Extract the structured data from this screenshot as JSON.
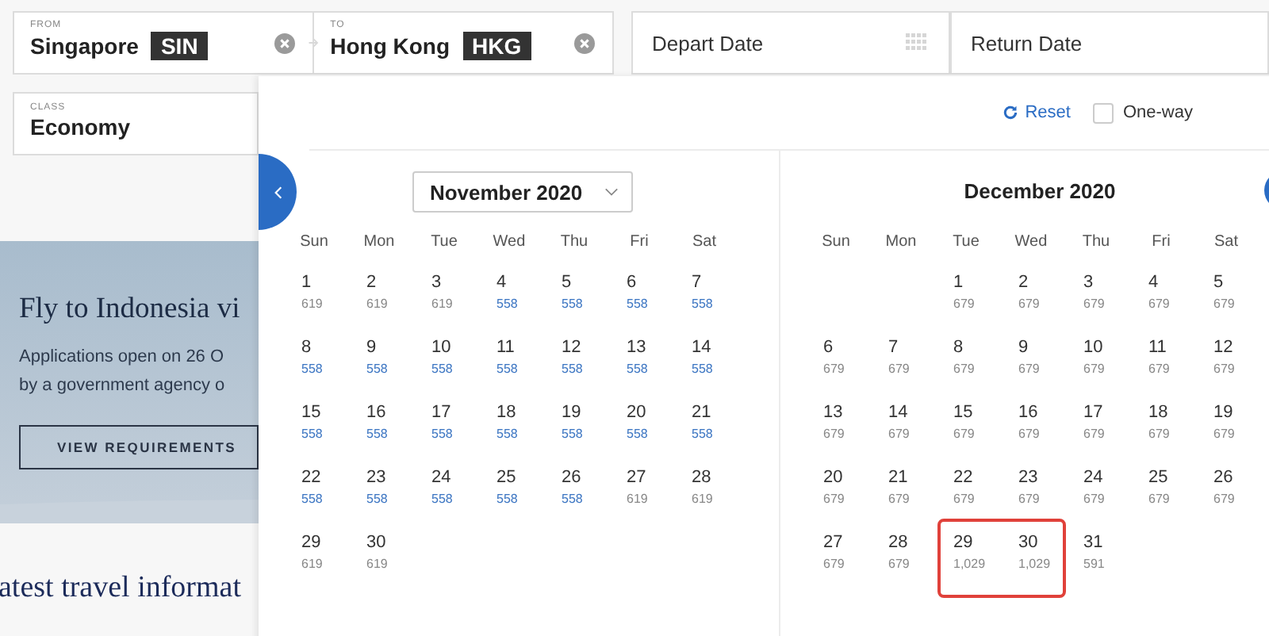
{
  "search": {
    "from": {
      "label": "FROM",
      "city": "Singapore",
      "code": "SIN"
    },
    "to": {
      "label": "TO",
      "city": "Hong Kong",
      "code": "HKG"
    },
    "depart": {
      "placeholder": "Depart Date"
    },
    "return": {
      "placeholder": "Return Date"
    },
    "class": {
      "label": "CLASS",
      "value": "Economy"
    }
  },
  "promo": {
    "title": "Fly to Indonesia vi",
    "text_lines": [
      "Applications open on 26 O",
      "by a government agency o"
    ],
    "button": "VIEW REQUIREMENTS"
  },
  "section_heading": "atest travel informat",
  "calendar": {
    "reset": "Reset",
    "one_way": {
      "label": "One-way",
      "checked": false
    },
    "months": [
      {
        "title": "November 2020",
        "kind": "dropdown",
        "weekdays": [
          "Sun",
          "Mon",
          "Tue",
          "Wed",
          "Thu",
          "Fri",
          "Sat"
        ],
        "weeks": [
          {
            "kind": "start",
            "days": [
              {
                "day": "1",
                "price": "619",
                "low_fare": false
              },
              {
                "day": "2",
                "price": "619",
                "low_fare": false
              },
              {
                "day": "3",
                "price": "619",
                "low_fare": false
              },
              {
                "day": "4",
                "price": "558",
                "low_fare": true
              },
              {
                "day": "5",
                "price": "558",
                "low_fare": true
              },
              {
                "day": "6",
                "price": "558",
                "low_fare": true
              },
              {
                "day": "7",
                "price": "558",
                "low_fare": true
              }
            ]
          },
          {
            "kind": "start",
            "days": [
              {
                "day": "8",
                "price": "558",
                "low_fare": true
              },
              {
                "day": "9",
                "price": "558",
                "low_fare": true
              },
              {
                "day": "10",
                "price": "558",
                "low_fare": true
              },
              {
                "day": "11",
                "price": "558",
                "low_fare": true
              },
              {
                "day": "12",
                "price": "558",
                "low_fare": true
              },
              {
                "day": "13",
                "price": "558",
                "low_fare": true
              },
              {
                "day": "14",
                "price": "558",
                "low_fare": true
              }
            ]
          },
          {
            "kind": "start",
            "days": [
              {
                "day": "15",
                "price": "558",
                "low_fare": true
              },
              {
                "day": "16",
                "price": "558",
                "low_fare": true
              },
              {
                "day": "17",
                "price": "558",
                "low_fare": true
              },
              {
                "day": "18",
                "price": "558",
                "low_fare": true
              },
              {
                "day": "19",
                "price": "558",
                "low_fare": true
              },
              {
                "day": "20",
                "price": "558",
                "low_fare": true
              },
              {
                "day": "21",
                "price": "558",
                "low_fare": true
              }
            ]
          },
          {
            "kind": "start",
            "days": [
              {
                "day": "22",
                "price": "558",
                "low_fare": true
              },
              {
                "day": "23",
                "price": "558",
                "low_fare": true
              },
              {
                "day": "24",
                "price": "558",
                "low_fare": true
              },
              {
                "day": "25",
                "price": "558",
                "low_fare": true
              },
              {
                "day": "26",
                "price": "558",
                "low_fare": true
              },
              {
                "day": "27",
                "price": "619",
                "low_fare": false
              },
              {
                "day": "28",
                "price": "619",
                "low_fare": false
              }
            ]
          },
          {
            "kind": "start",
            "days": [
              {
                "day": "29",
                "price": "619",
                "low_fare": false
              },
              {
                "day": "30",
                "price": "619",
                "low_fare": false
              }
            ]
          }
        ]
      },
      {
        "title": "December 2020",
        "kind": "label",
        "weekdays": [
          "Sun",
          "Mon",
          "Tue",
          "Wed",
          "Thu",
          "Fri",
          "Sat"
        ],
        "weeks": [
          {
            "kind": "end",
            "days": [
              {
                "day": "1",
                "price": "679",
                "low_fare": false
              },
              {
                "day": "2",
                "price": "679",
                "low_fare": false
              },
              {
                "day": "3",
                "price": "679",
                "low_fare": false
              },
              {
                "day": "4",
                "price": "679",
                "low_fare": false
              },
              {
                "day": "5",
                "price": "679",
                "low_fare": false
              }
            ]
          },
          {
            "kind": "start",
            "days": [
              {
                "day": "6",
                "price": "679",
                "low_fare": false
              },
              {
                "day": "7",
                "price": "679",
                "low_fare": false
              },
              {
                "day": "8",
                "price": "679",
                "low_fare": false
              },
              {
                "day": "9",
                "price": "679",
                "low_fare": false
              },
              {
                "day": "10",
                "price": "679",
                "low_fare": false
              },
              {
                "day": "11",
                "price": "679",
                "low_fare": false
              },
              {
                "day": "12",
                "price": "679",
                "low_fare": false
              }
            ]
          },
          {
            "kind": "start",
            "days": [
              {
                "day": "13",
                "price": "679",
                "low_fare": false
              },
              {
                "day": "14",
                "price": "679",
                "low_fare": false
              },
              {
                "day": "15",
                "price": "679",
                "low_fare": false
              },
              {
                "day": "16",
                "price": "679",
                "low_fare": false
              },
              {
                "day": "17",
                "price": "679",
                "low_fare": false
              },
              {
                "day": "18",
                "price": "679",
                "low_fare": false
              },
              {
                "day": "19",
                "price": "679",
                "low_fare": false
              }
            ]
          },
          {
            "kind": "start",
            "days": [
              {
                "day": "20",
                "price": "679",
                "low_fare": false
              },
              {
                "day": "21",
                "price": "679",
                "low_fare": false
              },
              {
                "day": "22",
                "price": "679",
                "low_fare": false
              },
              {
                "day": "23",
                "price": "679",
                "low_fare": false
              },
              {
                "day": "24",
                "price": "679",
                "low_fare": false
              },
              {
                "day": "25",
                "price": "679",
                "low_fare": false
              },
              {
                "day": "26",
                "price": "679",
                "low_fare": false
              }
            ]
          },
          {
            "kind": "start",
            "days": [
              {
                "day": "27",
                "price": "679",
                "low_fare": false
              },
              {
                "day": "28",
                "price": "679",
                "low_fare": false
              },
              {
                "day": "29",
                "price": "1,029",
                "low_fare": false,
                "highlighted": true
              },
              {
                "day": "30",
                "price": "1,029",
                "low_fare": false,
                "highlighted": true
              },
              {
                "day": "31",
                "price": "591",
                "low_fare": false
              }
            ]
          }
        ]
      }
    ]
  }
}
